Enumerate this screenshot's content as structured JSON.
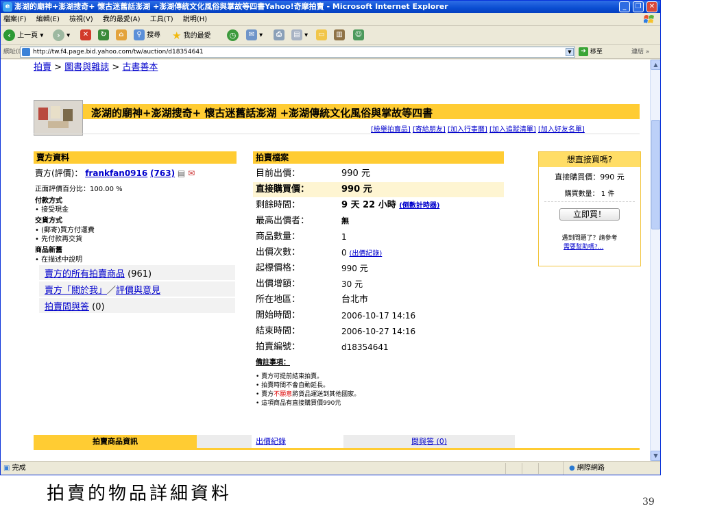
{
  "window": {
    "title": "澎湖的廟神+澎湖搜奇+ 懷古迷舊話澎湖 +澎湖傳統文化風俗與掌故等四書Yahoo!奇摩拍賣 - Microsoft Internet Explorer",
    "min": "_",
    "max": "❐",
    "close": "✕"
  },
  "menu": [
    "檔案(F)",
    "編輯(E)",
    "檢視(V)",
    "我的最愛(A)",
    "工具(T)",
    "說明(H)"
  ],
  "toolbar": {
    "back": "上一頁",
    "search": "搜尋",
    "favorites": "我的最愛"
  },
  "address": {
    "label": "網址(D)",
    "url": "http://tw.f4.page.bid.yahoo.com/tw/auction/d18354641",
    "go": "移至",
    "links": "連結 »"
  },
  "breadcrumb": {
    "root": "拍賣",
    "sep1": " > ",
    "cat1": "圖書與雜誌",
    "sep2": " > ",
    "cat2": "古書善本"
  },
  "item_title": "澎湖的廟神+澎湖搜奇+ 懷古迷舊話澎湖 +澎湖傳統文化風俗與掌故等四書",
  "item_links": {
    "report": "[檢舉拍賣品]",
    "send": "[寄給朋友]",
    "calendar": "[加入行事曆]",
    "watch": "[加入追蹤清單]",
    "friend": "[加入好友名單]"
  },
  "seller": {
    "header": "賣方資料",
    "label": "賣方(評價)：",
    "name": "frankfan0916",
    "rating": "(763)",
    "positive": "正面評價百分比：100.00 %",
    "payment_title": "付款方式",
    "payment": [
      "• 接受現金"
    ],
    "delivery_title": "交貨方式",
    "delivery": [
      "• (郵寄)買方付運費",
      "• 先付款再交貨"
    ],
    "condition_title": "商品新舊",
    "condition": [
      "• 在描述中說明"
    ],
    "all_items": "賣方的所有拍賣商品",
    "all_items_count": "(961)",
    "about": "賣方「關於我」",
    "about_sep": "／",
    "feedback": "評價與意見",
    "qa": "拍賣問與答",
    "qa_count": "(0)"
  },
  "auction": {
    "header": "拍賣檔案",
    "rows": [
      {
        "label": "目前出價：",
        "value": "990 元"
      },
      {
        "label": "直接購買價：",
        "value": "990 元"
      },
      {
        "label": "剩餘時間：",
        "value": "9 天 22 小時",
        "extra": "(倒數計時器)"
      },
      {
        "label": "最高出價者：",
        "value": "無"
      },
      {
        "label": "商品數量：",
        "value": "1"
      },
      {
        "label": "出價次數：",
        "value": "0",
        "extra": "(出價紀錄)"
      },
      {
        "label": "起標價格：",
        "value": "990 元"
      },
      {
        "label": "出價增額：",
        "value": "30 元"
      },
      {
        "label": "所在地區：",
        "value": "台北市"
      },
      {
        "label": "開始時間：",
        "value": "2006-10-17 14:16"
      },
      {
        "label": "結束時間：",
        "value": "2006-10-27 14:16"
      },
      {
        "label": "拍賣編號：",
        "value": "d18354641"
      }
    ],
    "notes_title": "備註事項：",
    "notes": [
      "• 賣方可提前結束拍賣。",
      "• 拍賣時間不會自動延長。",
      "• 賣方",
      "不願意",
      "將貨品運送到其他國家。",
      "• 這項商品有直接購買價990元"
    ]
  },
  "buybox": {
    "header": "想直接買嗎?",
    "price": "直接購買價：990 元",
    "qty": "購買數量： 1 件",
    "button": "立即買！",
    "help_q": "遇到問題了？請參考",
    "help_link": "需要幫助嗎?..."
  },
  "tabs": {
    "info": "拍賣商品資訊",
    "bids": "出價紀錄",
    "qa": "問與答 (0)"
  },
  "status": {
    "done": "完成",
    "zone": "網際網路"
  },
  "slide": {
    "caption": "拍賣的物品詳細資料",
    "page": "39"
  },
  "colors": {
    "accent": "#ffcc33",
    "link": "#0000cc",
    "titlebar": "#0a4dd1"
  }
}
